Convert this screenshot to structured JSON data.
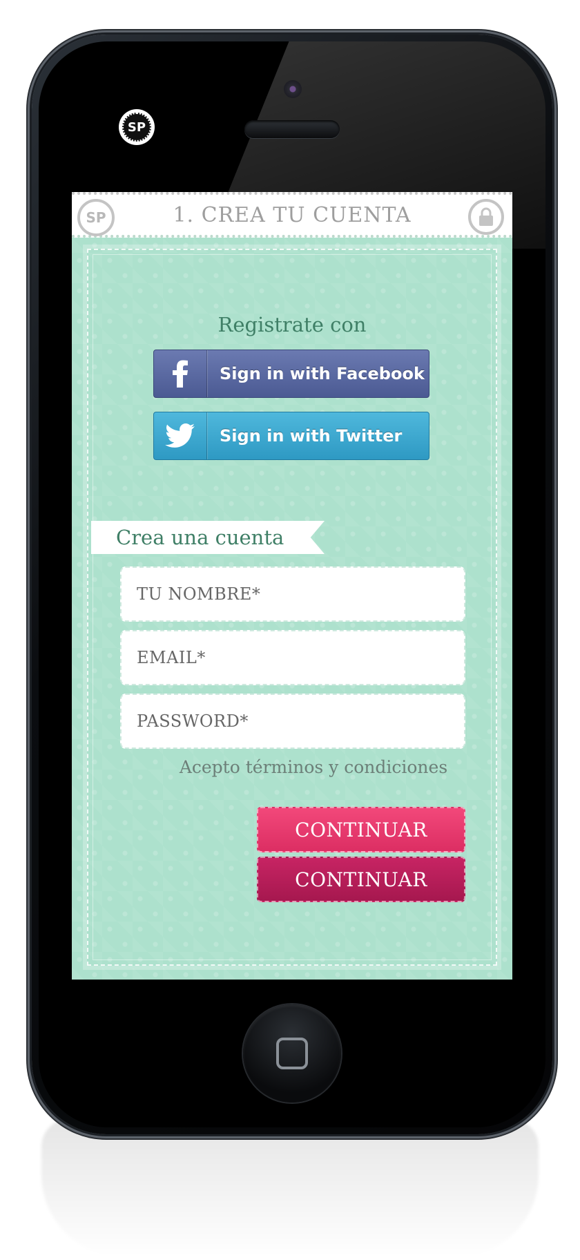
{
  "header": {
    "title": "1. CREA TU CUENTA",
    "logo_text": "SP"
  },
  "social": {
    "heading": "Registrate con",
    "facebook_label": "Sign in with Facebook",
    "twitter_label": "Sign in with Twitter"
  },
  "form": {
    "section_title": "Crea una cuenta",
    "name_placeholder": "TU NOMBRE*",
    "email_placeholder": "EMAIL*",
    "password_placeholder": "PASSWORD*",
    "terms_text": "Acepto términos y condiciones",
    "continue_label_1": "CONTINUAR",
    "continue_label_2": "CONTINUAR"
  },
  "device": {
    "bezel_logo_text": "SP"
  },
  "icons": {
    "header_logo": "sp-logo-icon",
    "header_lock": "lock-icon",
    "facebook": "facebook-icon",
    "twitter": "twitter-bird-icon"
  },
  "colors": {
    "screen_bg": "#ade1cd",
    "accent_green": "#3f7f66",
    "facebook_blue": "#5868a3",
    "twitter_blue": "#3ea8d0",
    "continue_pink": "#e8386d",
    "continue_dark_pink": "#b61d58"
  }
}
